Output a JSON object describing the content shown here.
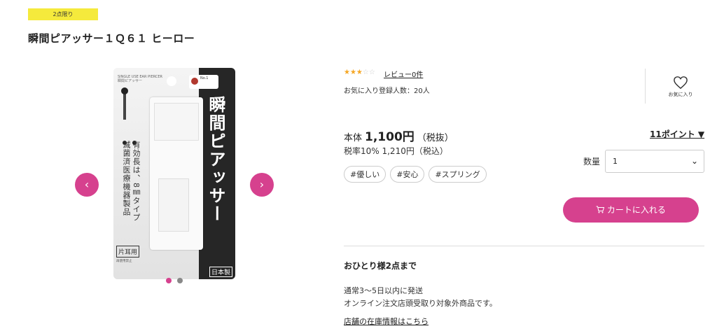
{
  "badge": "2点限り",
  "title": "瞬間ピアッサー１Ｑ６１ ヒーロー",
  "carousel": {
    "prev_icon": "chevron-left-icon",
    "next_icon": "chevron-right-icon",
    "prev_glyph": "‹",
    "next_glyph": "›",
    "slide_count": 2,
    "active_slide": 1
  },
  "package": {
    "en_text": "SINGLE USE EAR PIERCER",
    "en_sub": "瞬間ピアッサー",
    "vertical_title": "瞬間ピアッサー",
    "no1_label": "No.1",
    "vtext_a": "有効長は、8㎜タイプ",
    "vtext_b": "滅菌済医療機器製品",
    "side_label": "片耳用",
    "small_text": "再使用禁止",
    "made_in": "日本製"
  },
  "rating": {
    "stars_filled": "★★★",
    "stars_empty": "☆☆",
    "stars": 3,
    "max": 5,
    "review_link": "レビュー0件"
  },
  "favorites": {
    "count_text": "お気に入り登録人数：20人",
    "button_label": "お気に入り",
    "icon": "heart-icon"
  },
  "price": {
    "prefix": "本体",
    "amount": "1,100円",
    "suffix": "（税抜）",
    "tax_text": "税率10% 1,210円（税込）",
    "points": "11ポイント ▼"
  },
  "tags": [
    "#優しい",
    "#安心",
    "#スプリング"
  ],
  "quantity": {
    "label": "数量",
    "value": "1",
    "chevron": "⌄"
  },
  "cart": {
    "label": "カートに入れる",
    "icon": "cart-icon"
  },
  "limit_text": "おひとり様2点まで",
  "shipping": {
    "line1": "通常3〜5日以内に発送",
    "line2": "オンライン注文店頭受取り対象外商品です。"
  },
  "store_link": "店舗の在庫情報はこちら",
  "colors": {
    "accent": "#d6418e",
    "badge": "#f5ea3c",
    "star": "#f5a623"
  }
}
